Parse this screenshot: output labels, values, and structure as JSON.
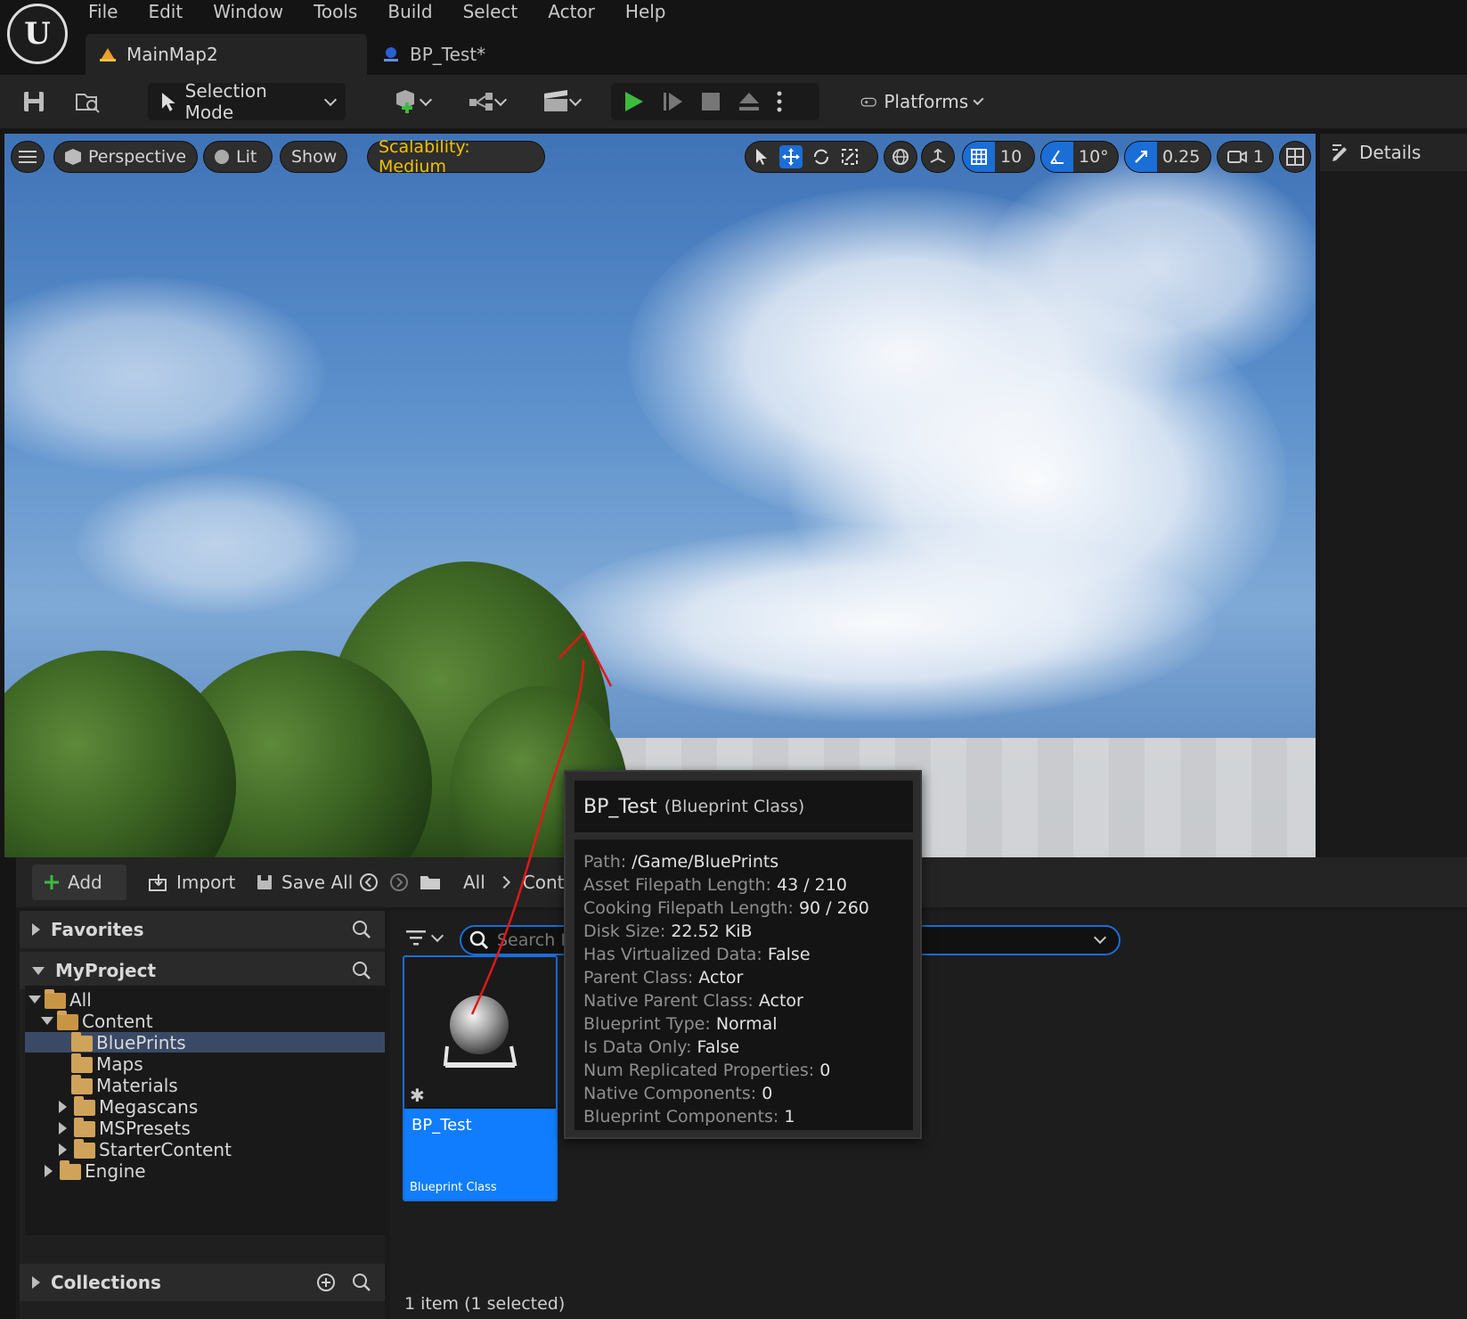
{
  "menu": [
    "File",
    "Edit",
    "Window",
    "Tools",
    "Build",
    "Select",
    "Actor",
    "Help"
  ],
  "tabs": [
    {
      "label": "MainMap2",
      "active": true
    },
    {
      "label": "BP_Test*",
      "active": false
    }
  ],
  "toolbar": {
    "mode_label": "Selection Mode",
    "platforms_label": "Platforms"
  },
  "viewport": {
    "perspective_label": "Perspective",
    "lit_label": "Lit",
    "show_label": "Show",
    "scalability_label": "Scalability: Medium",
    "grid_snap": "10",
    "rotation_snap": "10°",
    "scale_snap": "0.25",
    "camera_speed": "1"
  },
  "details": {
    "title": "Details"
  },
  "content_browser": {
    "add_label": "Add",
    "import_label": "Import",
    "save_all_label": "Save All",
    "path_all": "All",
    "path_content": "Conte",
    "search_placeholder": "Search E",
    "favorites_label": "Favorites",
    "project_label": "MyProject",
    "collections_label": "Collections",
    "tree": [
      {
        "label": "All",
        "depth": 0,
        "expanded": true,
        "selected": false
      },
      {
        "label": "Content",
        "depth": 1,
        "expanded": true,
        "selected": false
      },
      {
        "label": "BluePrints",
        "depth": 2,
        "expanded": false,
        "selected": true
      },
      {
        "label": "Maps",
        "depth": 2,
        "expanded": false,
        "selected": false
      },
      {
        "label": "Materials",
        "depth": 2,
        "expanded": false,
        "selected": false
      },
      {
        "label": "Megascans",
        "depth": 2,
        "expanded": false,
        "selected": false,
        "has_children": true
      },
      {
        "label": "MSPresets",
        "depth": 2,
        "expanded": false,
        "selected": false,
        "has_children": true
      },
      {
        "label": "StarterContent",
        "depth": 2,
        "expanded": false,
        "selected": false,
        "has_children": true
      },
      {
        "label": "Engine",
        "depth": 1,
        "expanded": false,
        "selected": false,
        "has_children": true
      }
    ],
    "asset": {
      "name": "BP_Test",
      "type": "Blueprint Class"
    },
    "status": "1 item (1 selected)"
  },
  "tooltip": {
    "title": "BP_Test",
    "subtitle": "(Blueprint Class)",
    "rows": [
      {
        "key": "Path:",
        "value": "/Game/BluePrints"
      },
      {
        "key": "Asset Filepath Length:",
        "value": "43 / 210"
      },
      {
        "key": "Cooking Filepath Length:",
        "value": "90 / 260"
      },
      {
        "key": "Disk Size:",
        "value": "22.52 KiB"
      },
      {
        "key": "Has Virtualized Data:",
        "value": "False"
      },
      {
        "key": "Parent Class:",
        "value": "Actor"
      },
      {
        "key": "Native Parent Class:",
        "value": "Actor"
      },
      {
        "key": "Blueprint Type:",
        "value": "Normal"
      },
      {
        "key": "Is Data Only:",
        "value": "False"
      },
      {
        "key": "Num Replicated Properties:",
        "value": "0"
      },
      {
        "key": "Native Components:",
        "value": "0"
      },
      {
        "key": "Blueprint Components:",
        "value": "1"
      }
    ]
  },
  "colors": {
    "accent": "#0f7dfd",
    "play": "#3dbb3d",
    "scalability": "#f0c200",
    "annotation": "#e01818"
  }
}
